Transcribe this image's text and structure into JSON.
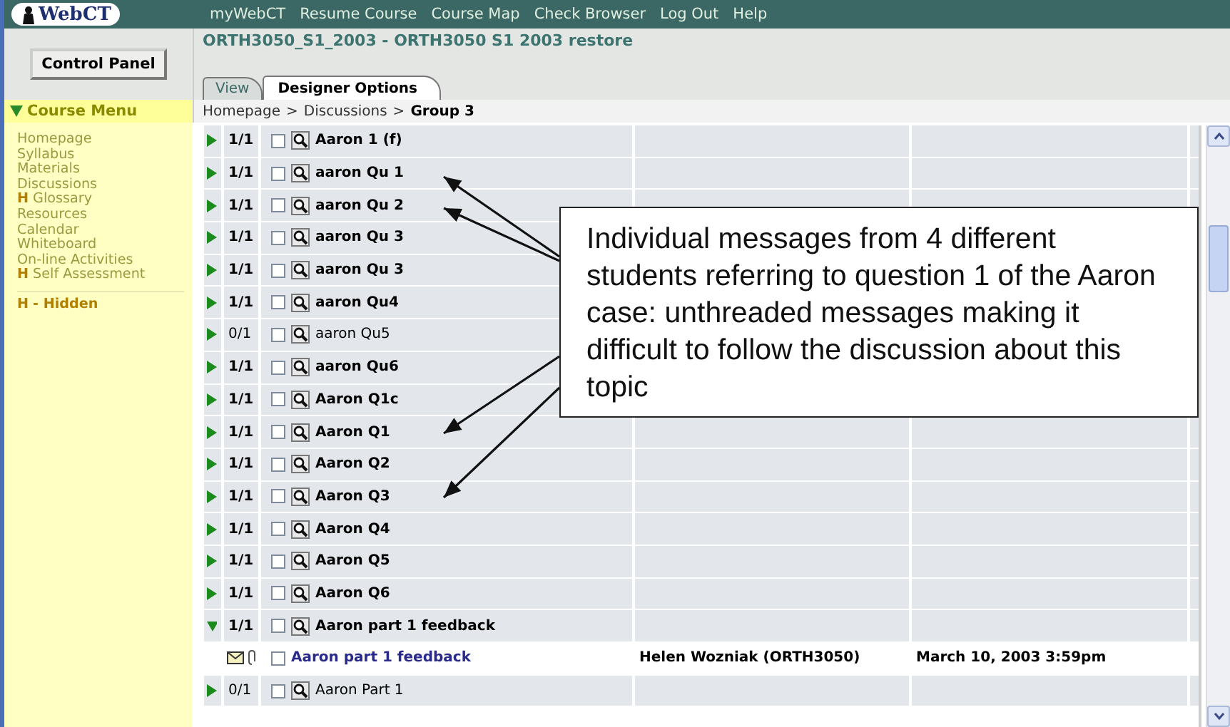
{
  "header": {
    "logo": "WebCT",
    "links": [
      "myWebCT",
      "Resume Course",
      "Course Map",
      "Check Browser",
      "Log Out",
      "Help"
    ]
  },
  "control_panel": {
    "label": "Control Panel"
  },
  "course": {
    "title": "ORTH3050_S1_2003 - ORTH3050 S1 2003 restore",
    "tabs": [
      {
        "label": "View",
        "selected": false
      },
      {
        "label": "Designer Options",
        "selected": true
      }
    ]
  },
  "course_menu": {
    "label": "Course Menu",
    "expanded": true,
    "items": [
      {
        "label": "Homepage"
      },
      {
        "label": "Syllabus"
      },
      {
        "label": "Materials"
      },
      {
        "label": "Discussions"
      },
      {
        "label": "Glossary",
        "mark": "H"
      },
      {
        "label": "Resources"
      },
      {
        "label": "Calendar"
      },
      {
        "label": "Whiteboard"
      },
      {
        "label": "On-line Activities"
      },
      {
        "label": "Self Assessment",
        "mark": "H"
      }
    ],
    "legend": {
      "mark": "H",
      "text": "- Hidden"
    }
  },
  "breadcrumb": {
    "separator": ">",
    "items": [
      {
        "label": "Homepage",
        "current": false
      },
      {
        "label": "Discussions",
        "current": false
      },
      {
        "label": "Group 3",
        "current": true
      }
    ]
  },
  "rows": [
    {
      "kind": "topic",
      "expanded": false,
      "count": "1/1",
      "unread": true,
      "checked": false,
      "title": "Aaron 1 (f)"
    },
    {
      "kind": "topic",
      "expanded": false,
      "count": "1/1",
      "unread": true,
      "checked": false,
      "title": "aaron Qu 1"
    },
    {
      "kind": "topic",
      "expanded": false,
      "count": "1/1",
      "unread": true,
      "checked": false,
      "title": "aaron Qu 2"
    },
    {
      "kind": "topic",
      "expanded": false,
      "count": "1/1",
      "unread": true,
      "checked": false,
      "title": "aaron Qu 3"
    },
    {
      "kind": "topic",
      "expanded": false,
      "count": "1/1",
      "unread": true,
      "checked": false,
      "title": "aaron Qu 3"
    },
    {
      "kind": "topic",
      "expanded": false,
      "count": "1/1",
      "unread": true,
      "checked": false,
      "title": "aaron Qu4"
    },
    {
      "kind": "topic",
      "expanded": false,
      "count": "0/1",
      "unread": false,
      "checked": false,
      "title": "aaron Qu5"
    },
    {
      "kind": "topic",
      "expanded": false,
      "count": "1/1",
      "unread": true,
      "checked": false,
      "title": "aaron Qu6"
    },
    {
      "kind": "topic",
      "expanded": false,
      "count": "1/1",
      "unread": true,
      "checked": false,
      "title": "Aaron Q1c"
    },
    {
      "kind": "topic",
      "expanded": false,
      "count": "1/1",
      "unread": true,
      "checked": false,
      "title": "Aaron Q1"
    },
    {
      "kind": "topic",
      "expanded": false,
      "count": "1/1",
      "unread": true,
      "checked": false,
      "title": "Aaron Q2"
    },
    {
      "kind": "topic",
      "expanded": false,
      "count": "1/1",
      "unread": true,
      "checked": false,
      "title": "Aaron Q3"
    },
    {
      "kind": "topic",
      "expanded": false,
      "count": "1/1",
      "unread": true,
      "checked": false,
      "title": "Aaron Q4"
    },
    {
      "kind": "topic",
      "expanded": false,
      "count": "1/1",
      "unread": true,
      "checked": false,
      "title": "Aaron Q5"
    },
    {
      "kind": "topic",
      "expanded": false,
      "count": "1/1",
      "unread": true,
      "checked": false,
      "title": "Aaron Q6"
    },
    {
      "kind": "topic",
      "expanded": true,
      "count": "1/1",
      "unread": true,
      "checked": false,
      "title": "Aaron part 1 feedback"
    },
    {
      "kind": "message",
      "attachment": true,
      "checked": false,
      "title": "Aaron part 1 feedback",
      "author": "Helen Wozniak (ORTH3050)",
      "date": "March 10, 2003 3:59pm"
    },
    {
      "kind": "topic",
      "expanded": false,
      "count": "0/1",
      "unread": false,
      "checked": false,
      "title": "Aaron Part 1"
    }
  ],
  "annotation": {
    "text": "Individual messages from 4 different students referring to question 1 of the Aaron case: unthreaded messages making it difficult to follow the discussion about this topic"
  }
}
